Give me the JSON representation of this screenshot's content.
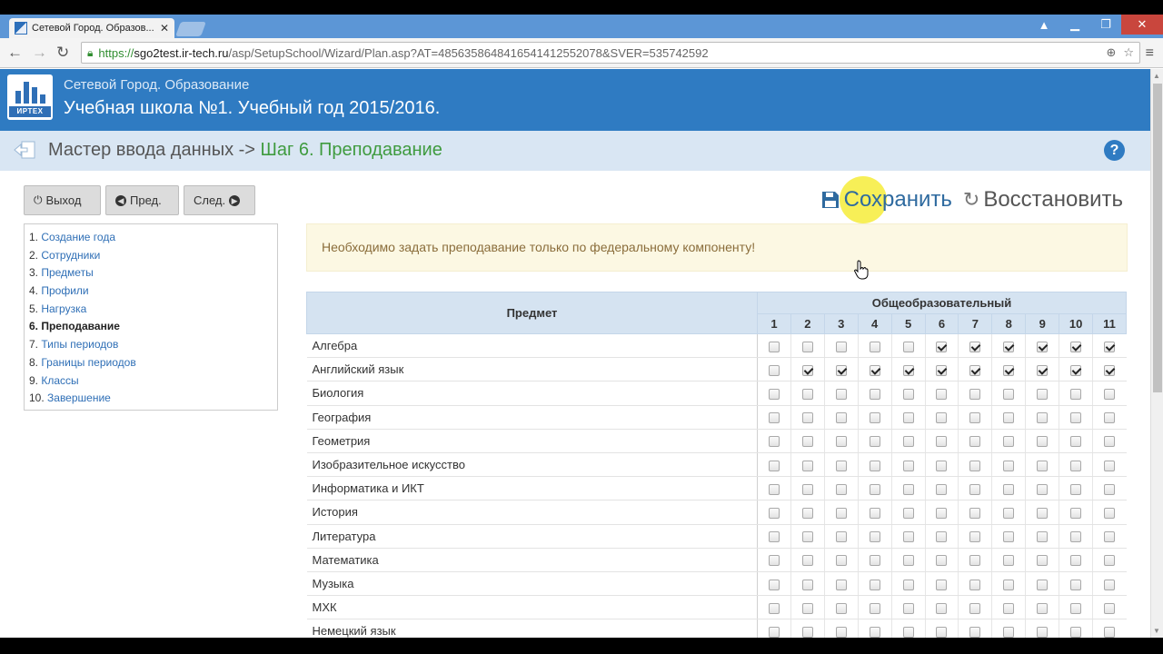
{
  "browser": {
    "tab_title": "Сетевой Город. Образов...",
    "url_scheme": "https://",
    "url_host": "sgo2test.ir-tech.ru",
    "url_rest": "/asp/SetupSchool/Wizard/Plan.asp?AT=4856358648416541412552078&SVER=535742592"
  },
  "header": {
    "brand": "ИРТЕХ",
    "subtitle": "Сетевой Город. Образование",
    "title": "Учебная школа №1. Учебный год 2015/2016."
  },
  "wizard": {
    "prefix": "Мастер ввода данных -> ",
    "step": "Шаг 6. Преподавание",
    "help": "?"
  },
  "nav_buttons": {
    "exit": "Выход",
    "prev": "Пред.",
    "next": "След."
  },
  "steps": [
    {
      "num": "1. ",
      "label": "Создание года",
      "current": false
    },
    {
      "num": "2. ",
      "label": "Сотрудники",
      "current": false
    },
    {
      "num": "3. ",
      "label": "Предметы",
      "current": false
    },
    {
      "num": "4. ",
      "label": "Профили",
      "current": false
    },
    {
      "num": "5. ",
      "label": "Нагрузка",
      "current": false
    },
    {
      "num": "6. ",
      "label": "Преподавание",
      "current": true
    },
    {
      "num": "7. ",
      "label": "Типы периодов",
      "current": false
    },
    {
      "num": "8. ",
      "label": "Границы периодов",
      "current": false
    },
    {
      "num": "9. ",
      "label": "Классы",
      "current": false
    },
    {
      "num": "10. ",
      "label": "Завершение",
      "current": false
    }
  ],
  "actions": {
    "save": "Сохранить",
    "restore": "Восстановить"
  },
  "alert": "Необходимо задать преподавание только по федеральному компоненту!",
  "table": {
    "col_subject": "Предмет",
    "col_group": "Общеобразовательный",
    "grades": [
      "1",
      "2",
      "3",
      "4",
      "5",
      "6",
      "7",
      "8",
      "9",
      "10",
      "11"
    ],
    "rows": [
      {
        "subject": "Алгебра",
        "checked": [
          0,
          0,
          0,
          0,
          0,
          1,
          1,
          1,
          1,
          1,
          1
        ]
      },
      {
        "subject": "Английский язык",
        "checked": [
          0,
          1,
          1,
          1,
          1,
          1,
          1,
          1,
          1,
          1,
          1
        ]
      },
      {
        "subject": "Биология",
        "checked": [
          0,
          0,
          0,
          0,
          0,
          0,
          0,
          0,
          0,
          0,
          0
        ]
      },
      {
        "subject": "География",
        "checked": [
          0,
          0,
          0,
          0,
          0,
          0,
          0,
          0,
          0,
          0,
          0
        ]
      },
      {
        "subject": "Геометрия",
        "checked": [
          0,
          0,
          0,
          0,
          0,
          0,
          0,
          0,
          0,
          0,
          0
        ]
      },
      {
        "subject": "Изобразительное искусство",
        "checked": [
          0,
          0,
          0,
          0,
          0,
          0,
          0,
          0,
          0,
          0,
          0
        ]
      },
      {
        "subject": "Информатика и ИКТ",
        "checked": [
          0,
          0,
          0,
          0,
          0,
          0,
          0,
          0,
          0,
          0,
          0
        ]
      },
      {
        "subject": "История",
        "checked": [
          0,
          0,
          0,
          0,
          0,
          0,
          0,
          0,
          0,
          0,
          0
        ]
      },
      {
        "subject": "Литература",
        "checked": [
          0,
          0,
          0,
          0,
          0,
          0,
          0,
          0,
          0,
          0,
          0
        ]
      },
      {
        "subject": "Математика",
        "checked": [
          0,
          0,
          0,
          0,
          0,
          0,
          0,
          0,
          0,
          0,
          0
        ]
      },
      {
        "subject": "Музыка",
        "checked": [
          0,
          0,
          0,
          0,
          0,
          0,
          0,
          0,
          0,
          0,
          0
        ]
      },
      {
        "subject": "МХК",
        "checked": [
          0,
          0,
          0,
          0,
          0,
          0,
          0,
          0,
          0,
          0,
          0
        ]
      },
      {
        "subject": "Немецкий язык",
        "checked": [
          0,
          0,
          0,
          0,
          0,
          0,
          0,
          0,
          0,
          0,
          0
        ]
      }
    ]
  },
  "colors": {
    "header_blue": "#2f7bc2",
    "wizard_bar": "#d9e6f3",
    "step_green": "#3f9b3f",
    "alert_bg": "#fcf8e3",
    "alert_text": "#8a6d3b"
  }
}
